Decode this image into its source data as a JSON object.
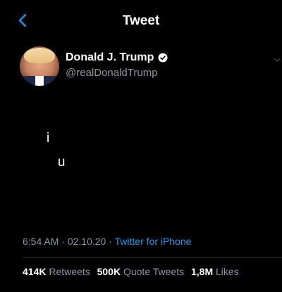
{
  "colors": {
    "background": "#000000",
    "accent": "#1d9bf0",
    "secondary_text": "#8b98a5",
    "primary_text": "#ffffff"
  },
  "nav": {
    "back_icon": "chevron-left-icon",
    "title": "Tweet"
  },
  "author": {
    "name": "Donald J. Trump",
    "verified_icon": "verified-badge-icon",
    "handle": "@realDonaldTrump"
  },
  "tweet": {
    "text": "i\n   u"
  },
  "meta": {
    "time": "6:54 AM",
    "separator1": " · ",
    "date": "02.10.20",
    "separator2": " · ",
    "source": "Twitter for iPhone"
  },
  "stats": {
    "retweets_count": "414K",
    "retweets_label": "Retweets",
    "quotes_count": "500K",
    "quotes_label": "Quote Tweets",
    "likes_count": "1,8M",
    "likes_label": "Likes"
  }
}
